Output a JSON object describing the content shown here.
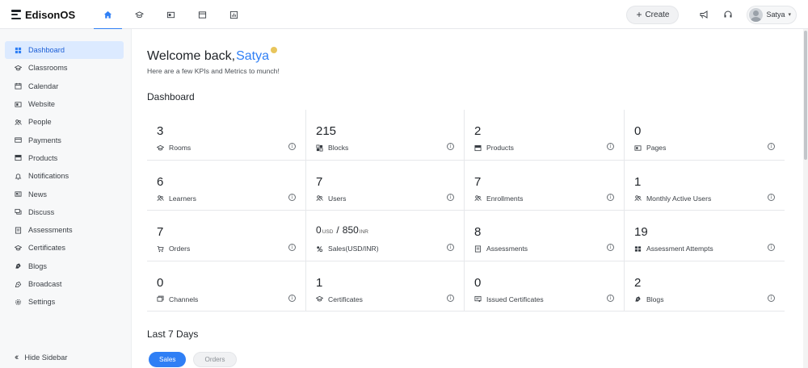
{
  "brand": {
    "name": "EdisonOS"
  },
  "topnav": [
    {
      "icon": "home-icon",
      "active": true
    },
    {
      "icon": "graduation-cap-icon",
      "active": false
    },
    {
      "icon": "website-icon",
      "active": false
    },
    {
      "icon": "store-icon",
      "active": false
    },
    {
      "icon": "bar-chart-icon",
      "active": false
    }
  ],
  "topbar": {
    "create_label": "Create",
    "user_name": "Satya"
  },
  "sidebar": {
    "items": [
      {
        "label": "Dashboard",
        "icon": "dashboard-icon",
        "active": true
      },
      {
        "label": "Classrooms",
        "icon": "graduation-cap-icon"
      },
      {
        "label": "Calendar",
        "icon": "calendar-icon"
      },
      {
        "label": "Website",
        "icon": "website-icon"
      },
      {
        "label": "People",
        "icon": "people-icon"
      },
      {
        "label": "Payments",
        "icon": "payments-icon"
      },
      {
        "label": "Products",
        "icon": "products-icon"
      },
      {
        "label": "Notifications",
        "icon": "bell-icon"
      },
      {
        "label": "News",
        "icon": "news-icon"
      },
      {
        "label": "Discuss",
        "icon": "discuss-icon"
      },
      {
        "label": "Assessments",
        "icon": "assessments-icon"
      },
      {
        "label": "Certificates",
        "icon": "certificate-icon"
      },
      {
        "label": "Blogs",
        "icon": "blogs-icon"
      },
      {
        "label": "Broadcast",
        "icon": "broadcast-icon"
      },
      {
        "label": "Settings",
        "icon": "settings-icon"
      }
    ],
    "hide_label": "Hide Sidebar"
  },
  "main": {
    "welcome_text": "Welcome back,",
    "welcome_name": "Satya",
    "subtitle": "Here are a few KPIs and Metrics to munch!",
    "dashboard_title": "Dashboard",
    "last7_title": "Last 7 Days",
    "tabs": [
      {
        "label": "Sales",
        "active": true
      },
      {
        "label": "Orders",
        "active": false
      }
    ]
  },
  "kpis": [
    {
      "value": "3",
      "label": "Rooms",
      "icon": "graduation-cap-icon"
    },
    {
      "value": "215",
      "label": "Blocks",
      "icon": "blocks-icon"
    },
    {
      "value": "2",
      "label": "Products",
      "icon": "products-icon"
    },
    {
      "value": "0",
      "label": "Pages",
      "icon": "website-icon"
    },
    {
      "value": "6",
      "label": "Learners",
      "icon": "people-icon"
    },
    {
      "value": "7",
      "label": "Users",
      "icon": "people-icon"
    },
    {
      "value": "7",
      "label": "Enrollments",
      "icon": "people-icon"
    },
    {
      "value": "1",
      "label": "Monthly Active Users",
      "icon": "people-icon"
    },
    {
      "value": "7",
      "label": "Orders",
      "icon": "cart-icon"
    },
    {
      "value_usd": "0",
      "unit_usd": "USD",
      "sep": "/",
      "value_inr": "850",
      "unit_inr": "INR",
      "label": "Sales(USD/INR)",
      "icon": "sales-icon"
    },
    {
      "value": "8",
      "label": "Assessments",
      "icon": "assessments-icon"
    },
    {
      "value": "19",
      "label": "Assessment Attempts",
      "icon": "attempts-icon"
    },
    {
      "value": "0",
      "label": "Channels",
      "icon": "channels-icon"
    },
    {
      "value": "1",
      "label": "Certificates",
      "icon": "graduation-cap-icon"
    },
    {
      "value": "0",
      "label": "Issued Certificates",
      "icon": "issued-certificate-icon"
    },
    {
      "value": "2",
      "label": "Blogs",
      "icon": "blogs-icon"
    }
  ],
  "colors": {
    "accent": "#2f7ff5",
    "active_bg": "#dceaff",
    "welcome_dot": "#e8c55c"
  }
}
